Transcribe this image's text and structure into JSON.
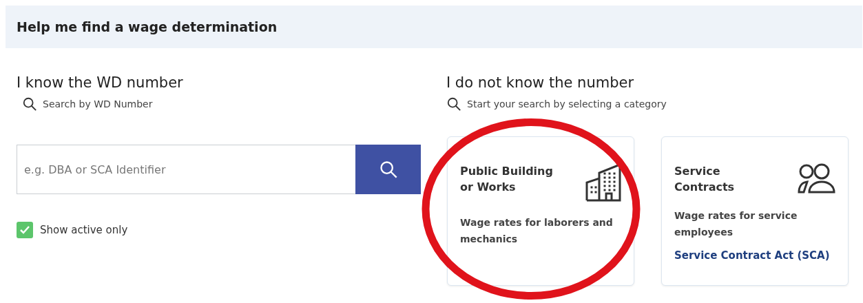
{
  "header": {
    "title": "Help me find a wage determination"
  },
  "known": {
    "heading": "I know the WD number",
    "hint": "Search by WD Number",
    "search": {
      "placeholder": "e.g. DBA or SCA Identifier"
    },
    "active_only": {
      "label": "Show active only",
      "checked": true
    }
  },
  "unknown": {
    "heading": "I do not know the number",
    "hint": "Start your search by selecting a category",
    "cards": [
      {
        "kind": "building",
        "title": "Public Building or Works",
        "description": "Wage rates for laborers and mechanics",
        "highlighted": true
      },
      {
        "kind": "people",
        "title": "Service Contracts",
        "description": "Wage rates for service employees",
        "link": "Service Contract Act (SCA)",
        "highlighted": false
      }
    ]
  }
}
